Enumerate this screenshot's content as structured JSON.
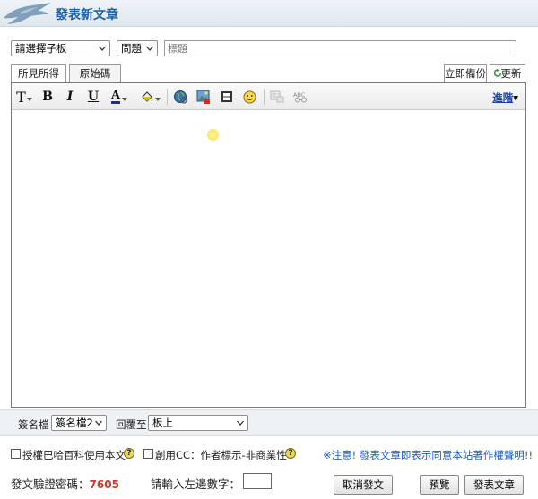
{
  "header": {
    "title": "發表新文章"
  },
  "compose": {
    "board_select": "請選擇子板",
    "category_select": "問題",
    "title_placeholder": "標題"
  },
  "editor": {
    "tabs": [
      {
        "label": "所見所得"
      },
      {
        "label": "原始碼"
      }
    ],
    "backup_button": "立即備份",
    "refresh_button": "更新",
    "toolbar": {
      "font_letter": "T",
      "bold": "B",
      "italic": "I",
      "underline": "U",
      "font_color_letter": "A",
      "advanced_link": "進階",
      "advanced_caret": "▾"
    },
    "content": ""
  },
  "footer": {
    "signature_label": "簽名檔",
    "signature_value": "簽名檔2",
    "reply_label": "回覆至",
    "reply_value": "板上",
    "license_bahamut": "授權巴哈百科使用本文",
    "license_cc": "創用CC：作者標示-非商業性",
    "notice": "※注意! 發表文章即表示同意本站著作權聲明!!",
    "verify_label": "發文驗證密碼：",
    "verify_code": "7605",
    "verify_prompt": "請輸入左邊數字：",
    "verify_input_value": "",
    "cancel_button": "取消發文",
    "preview_button": "預覽",
    "submit_button": "發表文章"
  },
  "colors": {
    "accent": "#1c5fa3",
    "notice": "#1a5cc4",
    "verify_code": "#c83a2e",
    "link": "#1a3fa8"
  }
}
